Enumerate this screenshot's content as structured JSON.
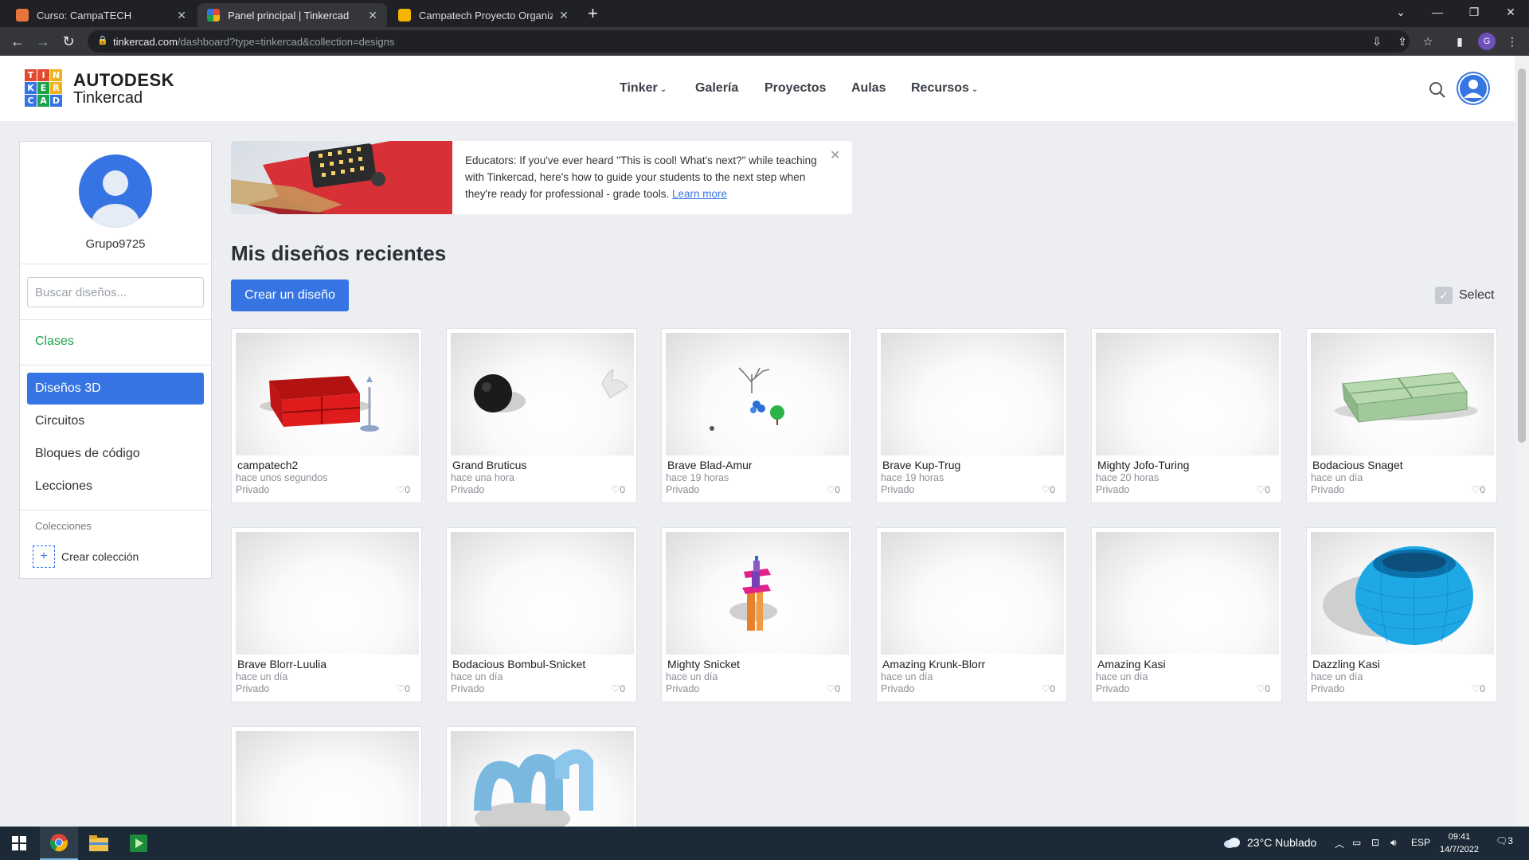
{
  "browser": {
    "tabs": [
      {
        "title": "Curso: CampaTECH",
        "favicon_color": "#e8743b",
        "active": false
      },
      {
        "title": "Panel principal | Tinkercad",
        "favicon_color": "#f4b400",
        "active": true
      },
      {
        "title": "Campatech Proyecto Organizado",
        "favicon_color": "#f5b400",
        "active": false
      }
    ],
    "new_tab_glyph": "+",
    "url_host": "tinkercad.com",
    "url_path": "/dashboard?type=tinkercad&collection=designs",
    "profile_initial": "G"
  },
  "header": {
    "logo_letters": [
      "T",
      "I",
      "N",
      "K",
      "E",
      "R",
      "C",
      "A",
      "D"
    ],
    "logo_colors": [
      "#e2492f",
      "#e2492f",
      "#f2b21b",
      "#3574e2",
      "#1aa34a",
      "#f2b21b",
      "#3574e2",
      "#1aa34a",
      "#3574e2"
    ],
    "brand_top": "AUTODESK",
    "brand_bottom": "Tinkercad",
    "nav": [
      {
        "label": "Tinker",
        "has_dropdown": true
      },
      {
        "label": "Galería",
        "has_dropdown": false
      },
      {
        "label": "Proyectos",
        "has_dropdown": false
      },
      {
        "label": "Aulas",
        "has_dropdown": false
      },
      {
        "label": "Recursos",
        "has_dropdown": true
      }
    ],
    "chevron_glyph": "⌄"
  },
  "sidebar": {
    "username": "Grupo9725",
    "search_placeholder": "Buscar diseños...",
    "clases": "Clases",
    "items": [
      {
        "label": "Diseños 3D",
        "active": true
      },
      {
        "label": "Circuitos",
        "active": false
      },
      {
        "label": "Bloques de código",
        "active": false
      },
      {
        "label": "Lecciones",
        "active": false
      }
    ],
    "collections_label": "Colecciones",
    "create_collection": "Crear colección"
  },
  "banner": {
    "text": "Educators: If you've ever heard \"This is cool! What's next?\" while teaching with Tinkercad, here's how to guide your students to the next step when they're ready for professional - grade tools.",
    "link": "Learn more",
    "close_glyph": "✕"
  },
  "main": {
    "title": "Mis diseños recientes",
    "create_button": "Crear un diseño",
    "select_label": "Select",
    "select_glyph": "✓"
  },
  "designs": [
    {
      "name": "campatech2",
      "time": "hace unos segundos",
      "privacy": "Privado",
      "likes": "0",
      "thumb": "red-shelf"
    },
    {
      "name": "Grand Bruticus",
      "time": "hace una hora",
      "privacy": "Privado",
      "likes": "0",
      "thumb": "black-sphere"
    },
    {
      "name": "Brave Blad-Amur",
      "time": "hace 19 horas",
      "privacy": "Privado",
      "likes": "0",
      "thumb": "tree-scene"
    },
    {
      "name": "Brave Kup-Trug",
      "time": "hace 19 horas",
      "privacy": "Privado",
      "likes": "0",
      "thumb": "empty"
    },
    {
      "name": "Mighty Jofo-Turing",
      "time": "hace 20 horas",
      "privacy": "Privado",
      "likes": "0",
      "thumb": "empty"
    },
    {
      "name": "Bodacious Snaget",
      "time": "hace un día",
      "privacy": "Privado",
      "likes": "0",
      "thumb": "green-tray"
    },
    {
      "name": "Brave Blorr-Luulia",
      "time": "hace un día",
      "privacy": "Privado",
      "likes": "0",
      "thumb": "empty"
    },
    {
      "name": "Bodacious Bombul-Snicket",
      "time": "hace un día",
      "privacy": "Privado",
      "likes": "0",
      "thumb": "empty"
    },
    {
      "name": "Mighty Snicket",
      "time": "hace un día",
      "privacy": "Privado",
      "likes": "0",
      "thumb": "tower"
    },
    {
      "name": "Amazing Krunk-Blorr",
      "time": "hace un día",
      "privacy": "Privado",
      "likes": "0",
      "thumb": "empty"
    },
    {
      "name": "Amazing Kasi",
      "time": "hace un día",
      "privacy": "Privado",
      "likes": "0",
      "thumb": "empty"
    },
    {
      "name": "Dazzling Kasi",
      "time": "hace un día",
      "privacy": "Privado",
      "likes": "0",
      "thumb": "blue-torus"
    },
    {
      "name": "",
      "time": "",
      "privacy": "",
      "likes": "",
      "thumb": "empty"
    },
    {
      "name": "",
      "time": "",
      "privacy": "",
      "likes": "",
      "thumb": "blue-letters"
    }
  ],
  "taskbar": {
    "weather": "23°C  Nublado",
    "language": "ESP",
    "time": "09:41",
    "date": "14/7/2022",
    "notifications": "3"
  },
  "colors": {
    "accent": "#3574e2",
    "green": "#1aa34a",
    "chrome_dark": "#202124"
  }
}
